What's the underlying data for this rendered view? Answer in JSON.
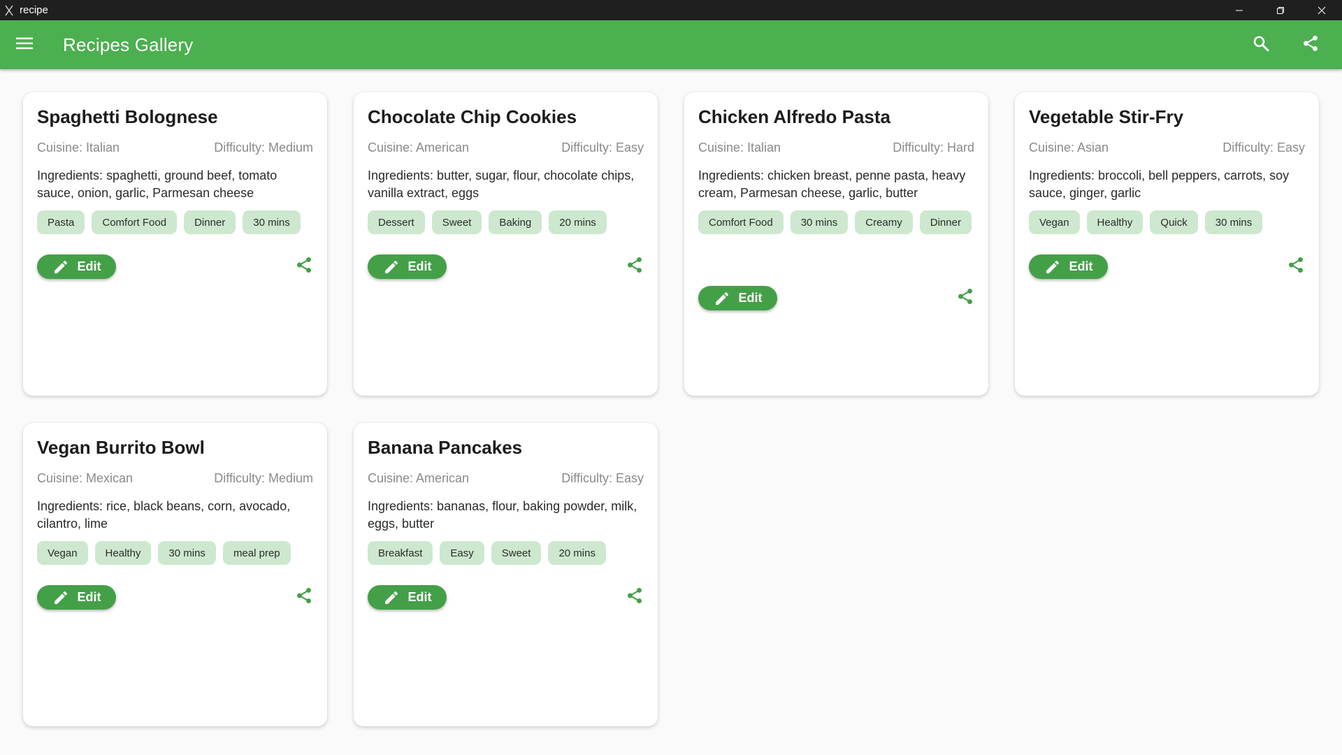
{
  "window": {
    "title": "recipe",
    "icon": "fork-knife-icon"
  },
  "appbar": {
    "title": "Recipes Gallery",
    "menu_icon": "menu-icon",
    "search_icon": "search-icon",
    "share_icon": "share-icon"
  },
  "colors": {
    "primary": "#4caf50",
    "button": "#43a047",
    "chip": "#cde8ce",
    "titlebar": "#1f1f1f",
    "background": "#fafafa"
  },
  "edit_label": "Edit",
  "recipes": [
    {
      "title": "Spaghetti Bolognese",
      "cuisine": "Cuisine: Italian",
      "difficulty": "Difficulty: Medium",
      "ingredients": "Ingredients: spaghetti, ground beef, tomato sauce, onion, garlic, Parmesan cheese",
      "tags": [
        "Pasta",
        "Comfort Food",
        "Dinner",
        "30 mins"
      ]
    },
    {
      "title": "Chocolate Chip Cookies",
      "cuisine": "Cuisine: American",
      "difficulty": "Difficulty: Easy",
      "ingredients": "Ingredients: butter, sugar, flour, chocolate chips, vanilla extract, eggs",
      "tags": [
        "Dessert",
        "Sweet",
        "Baking",
        "20 mins"
      ]
    },
    {
      "title": "Chicken Alfredo Pasta",
      "cuisine": "Cuisine: Italian",
      "difficulty": "Difficulty: Hard",
      "ingredients": "Ingredients: chicken breast, penne pasta, heavy cream, Parmesan cheese, garlic, butter",
      "tags": [
        "Comfort Food",
        "30 mins",
        "Creamy",
        "Dinner"
      ]
    },
    {
      "title": "Vegetable Stir-Fry",
      "cuisine": "Cuisine: Asian",
      "difficulty": "Difficulty: Easy",
      "ingredients": "Ingredients: broccoli, bell peppers, carrots, soy sauce, ginger, garlic",
      "tags": [
        "Vegan",
        "Healthy",
        "Quick",
        "30 mins"
      ]
    },
    {
      "title": "Vegan Burrito Bowl",
      "cuisine": "Cuisine: Mexican",
      "difficulty": "Difficulty: Medium",
      "ingredients": "Ingredients: rice, black beans, corn, avocado, cilantro, lime",
      "tags": [
        "Vegan",
        "Healthy",
        "30 mins",
        "meal prep"
      ]
    },
    {
      "title": "Banana Pancakes",
      "cuisine": "Cuisine: American",
      "difficulty": "Difficulty: Easy",
      "ingredients": "Ingredients: bananas, flour, baking powder, milk, eggs, butter",
      "tags": [
        "Breakfast",
        "Easy",
        "Sweet",
        "20 mins"
      ]
    }
  ]
}
